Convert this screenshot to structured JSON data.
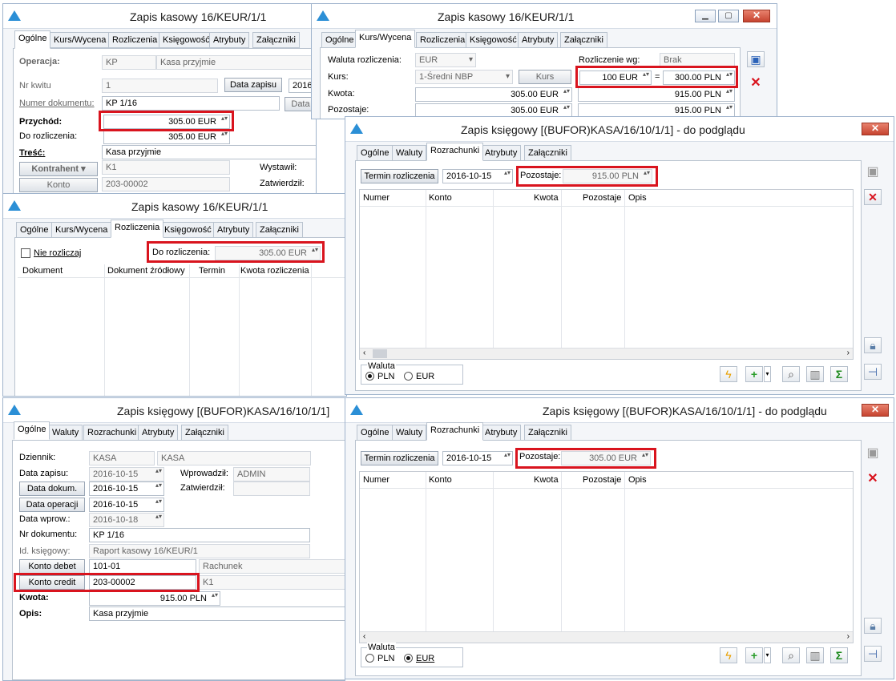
{
  "w1": {
    "title": "Zapis kasowy 16/KEUR/1/1",
    "tabs": [
      "Ogólne",
      "Kurs/Wycena",
      "Rozliczenia",
      "Księgowość",
      "Atrybuty",
      "Załączniki"
    ],
    "operacja_label": "Operacja:",
    "operacja_code": "KP",
    "operacja_name": "Kasa przyjmie",
    "nr_kwitu_label": "Nr kwitu",
    "nr_kwitu": "1",
    "data_zapisu_btn": "Data zapisu",
    "data_zapisu_val": "2016",
    "numer_dok_label": "Numer dokumentu:",
    "numer_dok": "KP 1/16",
    "data_btn": "Data",
    "przychod_label": "Przychód:",
    "przychod": "305.00 EUR",
    "do_rozliczenia_label": "Do rozliczenia:",
    "do_rozliczenia": "305.00 EUR",
    "tresc_label": "Treść:",
    "tresc": "Kasa przyjmie",
    "kontrahent_btn": "Kontrahent",
    "kontrahent": "K1",
    "wystawil_label": "Wystawił:",
    "konto_btn": "Konto",
    "konto": "203-00002",
    "zatwierdzil_label": "Zatwierdził:"
  },
  "w2": {
    "title": "Zapis kasowy 16/KEUR/1/1",
    "tabs": [
      "Ogólne",
      "Kurs/Wycena",
      "Rozliczenia",
      "Księgowość",
      "Atrybuty",
      "Załączniki"
    ],
    "waluta_label": "Waluta rozliczenia:",
    "waluta": "EUR",
    "rozliczenie_label": "Rozliczenie wg:",
    "rozliczenie": "Brak",
    "kurs_label": "Kurs:",
    "kurs_type": "1-Średni NBP",
    "kurs_btn": "Kurs",
    "kurs_from": "100 EUR",
    "eq": "=",
    "kurs_to": "300.00 PLN",
    "kwota_label": "Kwota:",
    "kwota_eur": "305.00 EUR",
    "kwota_pln": "915.00 PLN",
    "pozostaje_label": "Pozostaje:",
    "pozostaje_eur": "305.00 EUR",
    "pozostaje_pln": "915.00 PLN"
  },
  "w3": {
    "title": "Zapis kasowy 16/KEUR/1/1",
    "tabs": [
      "Ogólne",
      "Kurs/Wycena",
      "Rozliczenia",
      "Księgowość",
      "Atrybuty",
      "Załączniki"
    ],
    "nie_rozliczaj": "Nie rozliczaj",
    "do_rozliczenia_label": "Do rozliczenia:",
    "do_rozliczenia": "305.00 EUR",
    "columns": [
      "Dokument",
      "Dokument źródłowy",
      "Termin",
      "Kwota rozliczenia"
    ]
  },
  "w4": {
    "title": "Zapis księgowy [(BUFOR)KASA/16/10/1/1] - do podglądu",
    "tabs": [
      "Ogólne",
      "Waluty",
      "Rozrachunki",
      "Atrybuty",
      "Załączniki"
    ],
    "termin_btn": "Termin rozliczenia",
    "termin": "2016-10-15",
    "pozostaje_label": "Pozostaje:",
    "pozostaje": "915.00 PLN",
    "columns": [
      "Numer",
      "Konto",
      "Kwota",
      "Pozostaje",
      "Opis"
    ],
    "waluta_label": "Waluta",
    "radio_pln": "PLN",
    "radio_eur": "EUR"
  },
  "w5": {
    "title": "Zapis księgowy [(BUFOR)KASA/16/10/1/1]",
    "tabs": [
      "Ogólne",
      "Waluty",
      "Rozrachunki",
      "Atrybuty",
      "Załączniki"
    ],
    "dziennik_label": "Dziennik:",
    "dziennik1": "KASA",
    "dziennik2": "KASA",
    "data_zapisu_label": "Data zapisu:",
    "data_zapisu": "2016-10-15",
    "wprowadzil_label": "Wprowadził:",
    "wprowadzil": "ADMIN",
    "data_dokum_btn": "Data dokum.",
    "data_dokum": "2016-10-15",
    "zatwierdzil_label": "Zatwierdził:",
    "data_operacji_btn": "Data operacji",
    "data_operacji": "2016-10-15",
    "data_wprow_label": "Data wprow.:",
    "data_wprow": "2016-10-18",
    "nr_dok_label": "Nr dokumentu:",
    "nr_dok": "KP 1/16",
    "id_ksiegowy_label": "Id. księgowy:",
    "id_ksiegowy": "Raport kasowy 16/KEUR/1",
    "konto_debet_btn": "Konto debet",
    "konto_debet": "101-01",
    "rachunek": "Rachunek",
    "konto_credit_btn": "Konto credit",
    "konto_credit": "203-00002",
    "konto_credit_name": "K1",
    "kwota_label": "Kwota:",
    "kwota": "915.00 PLN",
    "opis_label": "Opis:",
    "opis": "Kasa przyjmie"
  },
  "w6": {
    "title": "Zapis księgowy [(BUFOR)KASA/16/10/1/1] - do podglądu",
    "tabs": [
      "Ogólne",
      "Waluty",
      "Rozrachunki",
      "Atrybuty",
      "Załączniki"
    ],
    "termin_btn": "Termin rozliczenia",
    "termin": "2016-10-15",
    "pozostaje_label": "Pozostaje:",
    "pozostaje": "305.00 EUR",
    "columns": [
      "Numer",
      "Konto",
      "Kwota",
      "Pozostaje",
      "Opis"
    ],
    "waluta_label": "Waluta",
    "radio_pln": "PLN",
    "radio_eur": "EUR"
  },
  "colors": {
    "highlight": "#d9141e",
    "accent": "#2b8fd6"
  }
}
